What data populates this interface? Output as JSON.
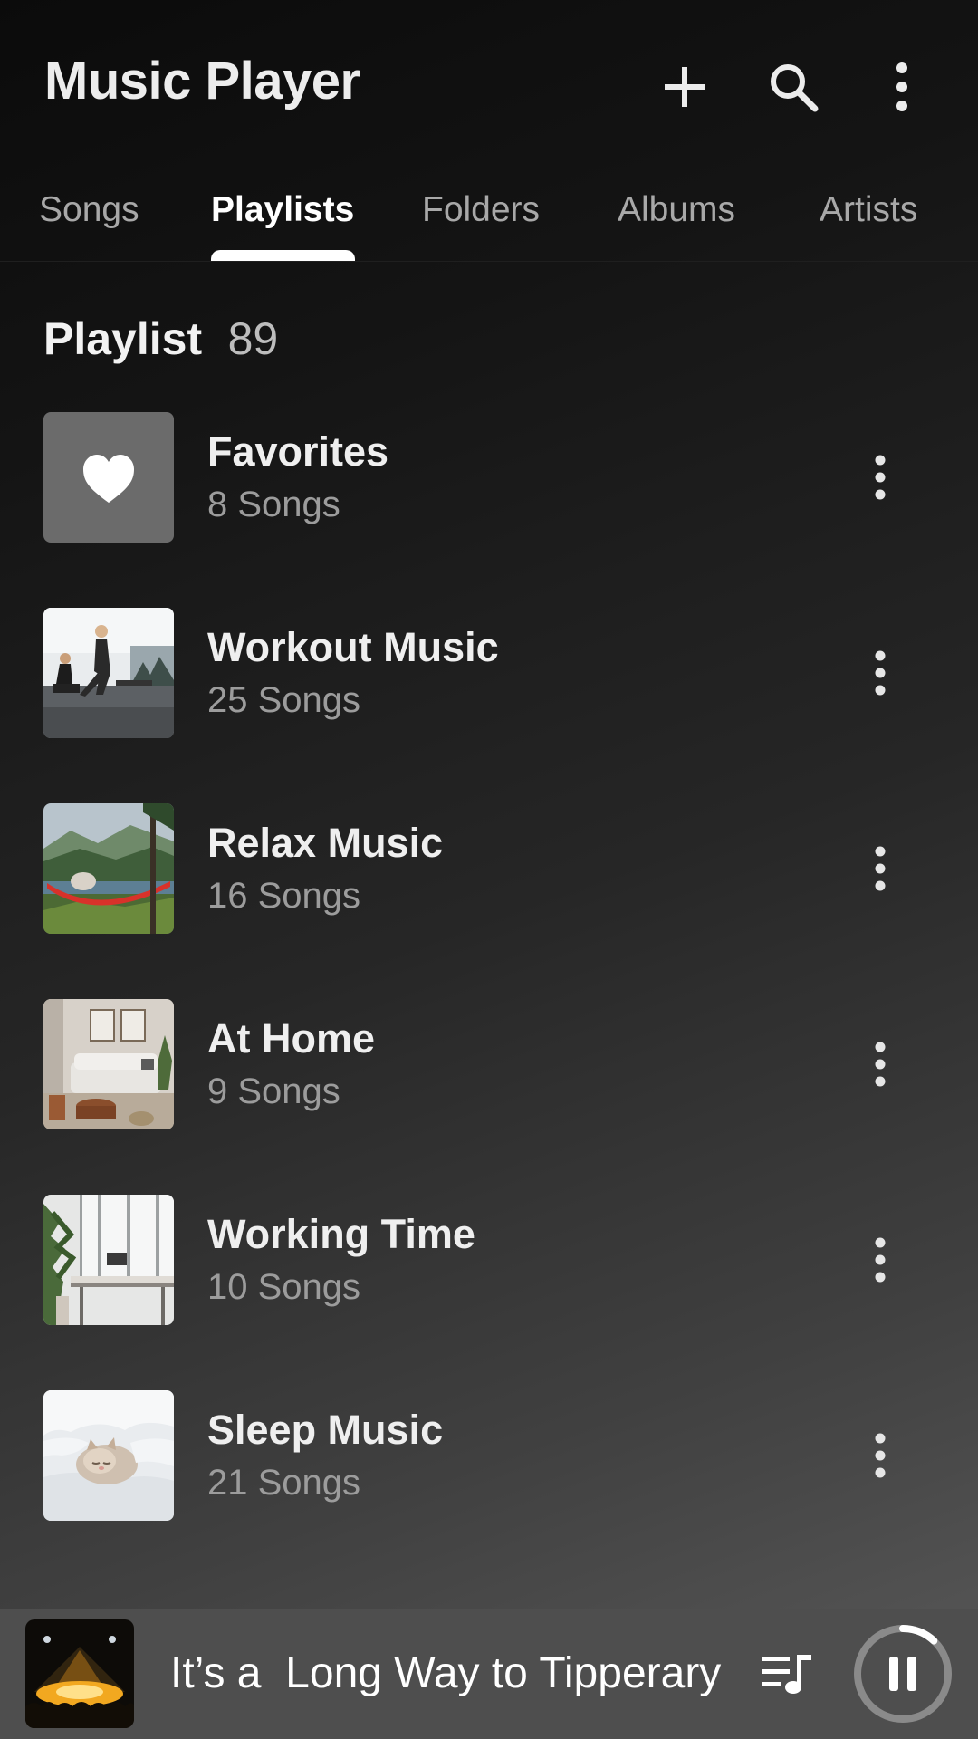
{
  "app": {
    "title": "Music Player",
    "accent_color": "#ffffff",
    "background_gradient": [
      "#0b0b0b",
      "#5a5a5a"
    ]
  },
  "header": {
    "actions": [
      {
        "icon": "plus-icon"
      },
      {
        "icon": "search-icon"
      },
      {
        "icon": "more-vertical-icon"
      }
    ]
  },
  "tabs": [
    {
      "label": "Songs",
      "active": false
    },
    {
      "label": "Playlists",
      "active": true
    },
    {
      "label": "Folders",
      "active": false
    },
    {
      "label": "Albums",
      "active": false
    },
    {
      "label": "Artists",
      "active": false
    }
  ],
  "section": {
    "title": "Playlist",
    "count": "89"
  },
  "playlists": [
    {
      "name": "Favorites",
      "count": "8 Songs",
      "thumbnail": "heart-icon"
    },
    {
      "name": "Workout Music",
      "count": "25 Songs",
      "thumbnail": "workout-photo"
    },
    {
      "name": "Relax Music",
      "count": "16 Songs",
      "thumbnail": "hammock-landscape-photo"
    },
    {
      "name": "At Home",
      "count": "9 Songs",
      "thumbnail": "living-room-photo"
    },
    {
      "name": "Working Time",
      "count": "10 Songs",
      "thumbnail": "office-desk-photo"
    },
    {
      "name": "Sleep Music",
      "count": "21 Songs",
      "thumbnail": "sleeping-cat-photo"
    }
  ],
  "now_playing": {
    "title": "It’s a  Long Way to Tipperary",
    "artwork": "concert-photo",
    "playback_progress": 0.12,
    "state": "playing"
  }
}
